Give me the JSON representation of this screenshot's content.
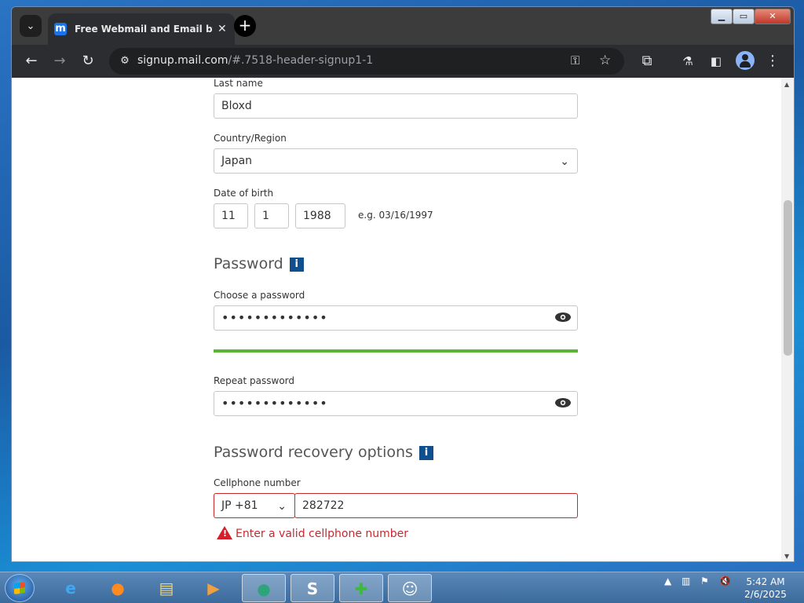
{
  "browser": {
    "tab_title": "Free Webmail and Email by mail.com",
    "tab_favicon": "m",
    "url_host": "signup.mail.com",
    "url_path": "/#.7518-header-signup1-1"
  },
  "form": {
    "last_name_label": "Last name",
    "last_name_value": "Bloxd",
    "country_label": "Country/Region",
    "country_value": "Japan",
    "dob_label": "Date of birth",
    "dob_month": "11",
    "dob_day": "1",
    "dob_year": "1988",
    "dob_hint": "e.g. 03/16/1997",
    "password_heading": "Password",
    "choose_password_label": "Choose a password",
    "choose_password_value": "•••••••••••••",
    "repeat_password_label": "Repeat password",
    "repeat_password_value": "•••••••••••••",
    "recovery_heading": "Password recovery options",
    "cellphone_label": "Cellphone number",
    "country_code": "JP +81",
    "cellphone_value": "282722",
    "cellphone_error": "Enter a valid cellphone number",
    "info_glyph": "i",
    "password_strength": 1.0,
    "password_strength_color": "#5cb531",
    "error_color": "#c9282d"
  },
  "taskbar": {
    "time": "5:42 AM",
    "date": "2/6/2025",
    "apps": [
      "internet-explorer",
      "firefox",
      "file-explorer",
      "media-player",
      "app-green-circle",
      "skype",
      "app-plus",
      "contacts"
    ]
  }
}
